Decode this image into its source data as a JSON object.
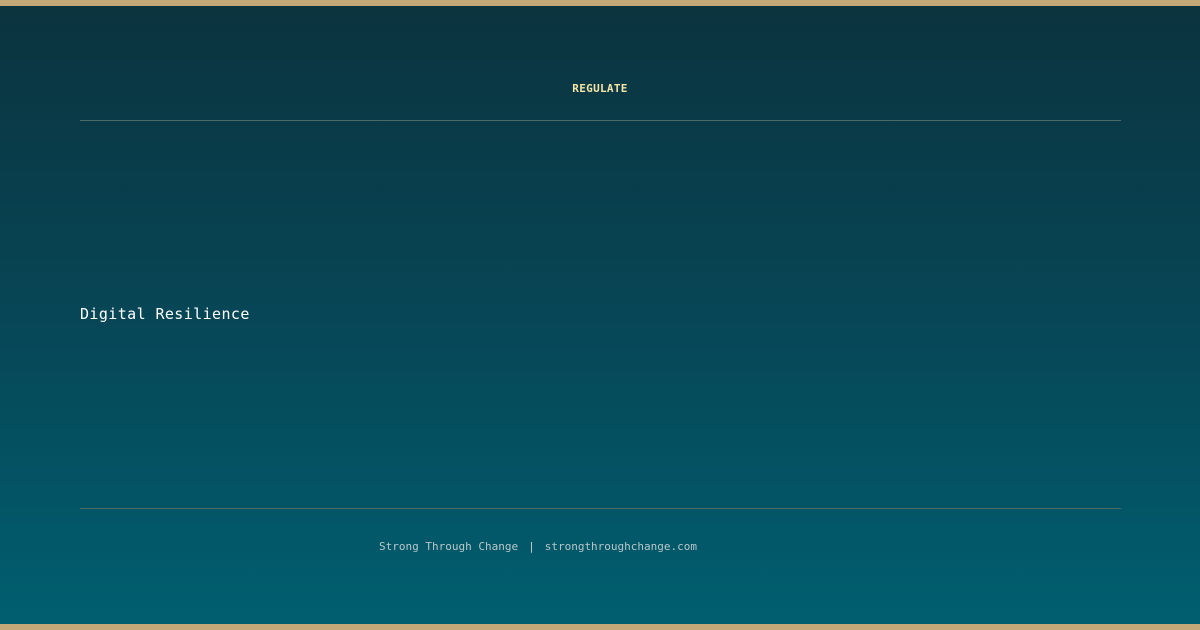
{
  "header": {
    "label": "REGULATE"
  },
  "main": {
    "headline": "Digital Resilience"
  },
  "footer": {
    "brand": "Strong Through Change",
    "separator": "|",
    "url": "strongthroughchange.com"
  },
  "colors": {
    "accent_border": "#c4a877",
    "header_label": "#f4e4a6",
    "bg_top": "#0b333e",
    "bg_bottom": "#005f70"
  }
}
